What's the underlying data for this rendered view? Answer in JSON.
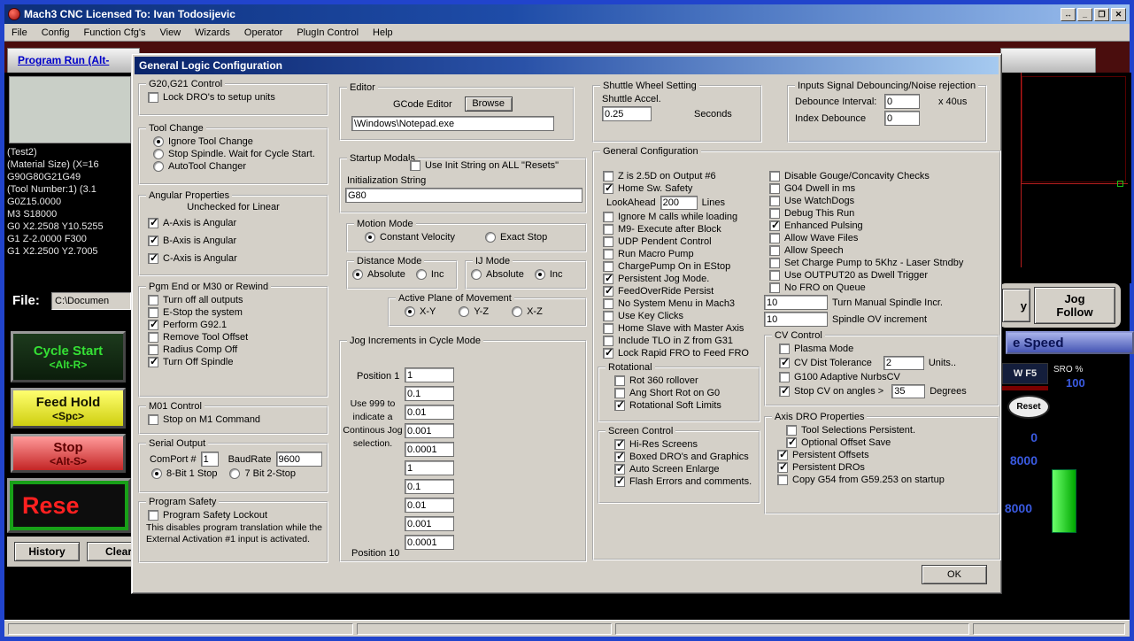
{
  "app": {
    "title": "Mach3 CNC  Licensed To: Ivan Todosijevic",
    "menus": [
      "File",
      "Config",
      "Function Cfg's",
      "View",
      "Wizards",
      "Operator",
      "PlugIn Control",
      "Help"
    ],
    "tab": "Program Run (Alt-",
    "icons": {
      "resize": "↔",
      "minimize": "_",
      "maximize": "❐",
      "close": "✕"
    }
  },
  "left": {
    "gcode": [
      "(Test2)",
      "(Material Size) (X=16",
      "G90G80G21G49",
      "(Tool Number:1) (3.1",
      "G0Z15.0000",
      "M3 S18000",
      "G0 X2.2508 Y10.5255",
      "G1  Z-2.0000 F300",
      "G1 X2.2500 Y2.7005"
    ],
    "file_label": "File:",
    "file_value": "C:\\Documen",
    "cycle_start": "Cycle Start",
    "cycle_start_key": "<Alt-R>",
    "feed_hold": "Feed Hold",
    "feed_hold_key": "<Spc>",
    "stop": "Stop",
    "stop_key": "<Alt-S>",
    "reset": "Rese",
    "history": "History",
    "clear": "Clear"
  },
  "right": {
    "partial_btn": "y",
    "jog1": "Jog",
    "jog2": "Follow",
    "speed_header": "e Speed",
    "fkey": "W F5",
    "sro_label": "SRO %",
    "sro_value": "100",
    "reset_btn": "Reset",
    "v0": "0",
    "v1": "8000",
    "v2": "8000"
  },
  "dialog": {
    "title": "General Logic Configuration",
    "ok": "OK",
    "g20": {
      "title": "G20,G21 Control",
      "lock_dros": {
        "label": "Lock DRO's to setup units",
        "checked": false
      }
    },
    "tool_change": {
      "title": "Tool Change",
      "items": [
        {
          "label": "Ignore Tool Change",
          "checked": true
        },
        {
          "label": "Stop Spindle. Wait for Cycle Start.",
          "checked": false
        },
        {
          "label": "AutoTool Changer",
          "checked": false
        }
      ]
    },
    "angular": {
      "title": "Angular Properties",
      "note": "Unchecked for Linear",
      "items": [
        {
          "label": "A-Axis is Angular",
          "checked": true
        },
        {
          "label": "B-Axis is Angular",
          "checked": true
        },
        {
          "label": "C-Axis is Angular",
          "checked": true
        }
      ]
    },
    "pgm_end": {
      "title": "Pgm End or M30 or Rewind",
      "items": [
        {
          "label": "Turn off all outputs",
          "checked": false
        },
        {
          "label": "E-Stop the system",
          "checked": false
        },
        {
          "label": "Perform G92.1",
          "checked": true
        },
        {
          "label": "Remove Tool Offset",
          "checked": false
        },
        {
          "label": "Radius Comp Off",
          "checked": false
        },
        {
          "label": "Turn Off Spindle",
          "checked": true
        }
      ]
    },
    "m01": {
      "title": "M01 Control",
      "stop_m1": {
        "label": "Stop on M1 Command",
        "checked": false
      }
    },
    "serial": {
      "title": "Serial Output",
      "comport_label": "ComPort #",
      "comport_value": "1",
      "baud_label": "BaudRate",
      "baud_value": "9600",
      "bits": [
        {
          "label": "8-Bit 1 Stop",
          "checked": true
        },
        {
          "label": "7 Bit 2-Stop",
          "checked": false
        }
      ]
    },
    "safety": {
      "title": "Program Safety",
      "lockout": {
        "label": "Program Safety Lockout",
        "checked": false
      },
      "note": "This disables program translation while the\nExternal Activation #1 input is activated."
    },
    "editor": {
      "title": "Editor",
      "label": "GCode Editor",
      "browse": "Browse",
      "path": "\\Windows\\Notepad.exe"
    },
    "startup": {
      "title": "Startup Modals",
      "use_init": {
        "label": "Use Init String on ALL  \"Resets\"",
        "checked": false
      },
      "init_label": "Initialization String",
      "init_value": "G80"
    },
    "motion": {
      "title": "Motion Mode",
      "items": [
        {
          "label": "Constant Velocity",
          "checked": true
        },
        {
          "label": "Exact Stop",
          "checked": false
        }
      ]
    },
    "distance": {
      "title": "Distance Mode",
      "items": [
        {
          "label": "Absolute",
          "checked": true
        },
        {
          "label": "Inc",
          "checked": false
        }
      ]
    },
    "ij": {
      "title": "IJ Mode",
      "items": [
        {
          "label": "Absolute",
          "checked": false
        },
        {
          "label": "Inc",
          "checked": true
        }
      ]
    },
    "plane": {
      "title": "Active Plane of Movement",
      "items": [
        {
          "label": "X-Y",
          "checked": true
        },
        {
          "label": "Y-Z",
          "checked": false
        },
        {
          "label": "X-Z",
          "checked": false
        }
      ]
    },
    "jog": {
      "title": "Jog Increments in Cycle Mode",
      "pos1_label": "Position 1",
      "pos10_label": "Position 10",
      "note": "Use 999 to\nindicate a\nContinous Jog\nselection.",
      "values": [
        "1",
        "0.1",
        "0.01",
        "0.001",
        "0.0001",
        "1",
        "0.1",
        "0.01",
        "0.001",
        "0.0001"
      ]
    },
    "shuttle": {
      "title": "Shuttle Wheel Setting",
      "accel_label": "Shuttle Accel.",
      "accel_value": "0.25",
      "unit": "Seconds"
    },
    "debounce": {
      "title": "Inputs Signal Debouncing/Noise rejection",
      "interval_label": "Debounce Interval:",
      "interval_value": "0",
      "unit": "x 40us",
      "index_label": "Index Debounce",
      "index_value": "0"
    },
    "general": {
      "title": "General Configuration",
      "left": [
        {
          "label": "Z is 2.5D on Output #6",
          "checked": false
        },
        {
          "label": "Home Sw. Safety",
          "checked": true
        }
      ],
      "lookahead_label": "LookAhead",
      "lookahead_value": "200",
      "lookahead_unit": "Lines",
      "left2": [
        {
          "label": "Ignore M calls while loading",
          "checked": false
        },
        {
          "label": "M9- Execute after Block",
          "checked": false
        },
        {
          "label": "UDP Pendent Control",
          "checked": false
        },
        {
          "label": "Run Macro Pump",
          "checked": false
        },
        {
          "label": "ChargePump On in EStop",
          "checked": false
        },
        {
          "label": "Persistent Jog Mode.",
          "checked": true
        },
        {
          "label": "FeedOverRide Persist",
          "checked": true
        },
        {
          "label": "No System Menu in Mach3",
          "checked": false
        },
        {
          "label": "Use Key Clicks",
          "checked": false
        },
        {
          "label": "Home Slave with Master Axis",
          "checked": false
        },
        {
          "label": "Include TLO in Z from G31",
          "checked": false
        },
        {
          "label": "Lock Rapid FRO to Feed FRO",
          "checked": true
        }
      ],
      "right": [
        {
          "label": "Disable Gouge/Concavity Checks",
          "checked": false
        },
        {
          "label": "G04 Dwell in ms",
          "checked": false
        },
        {
          "label": "Use WatchDogs",
          "checked": false
        },
        {
          "label": "Debug This Run",
          "checked": false
        },
        {
          "label": "Enhanced Pulsing",
          "checked": true
        },
        {
          "label": "Allow Wave Files",
          "checked": false
        },
        {
          "label": "Allow Speech",
          "checked": false
        },
        {
          "label": "Set Charge Pump to 5Khz - Laser Stndby",
          "checked": false
        },
        {
          "label": "Use OUTPUT20 as Dwell Trigger",
          "checked": false
        },
        {
          "label": "No FRO on Queue",
          "checked": false
        }
      ],
      "spindle_incr_value": "10",
      "spindle_incr_label": "Turn Manual Spindle Incr.",
      "spindle_ov_value": "10",
      "spindle_ov_label": "Spindle OV increment"
    },
    "rotational": {
      "title": "Rotational",
      "items": [
        {
          "label": "Rot 360 rollover",
          "checked": false
        },
        {
          "label": "Ang Short Rot on G0",
          "checked": false
        },
        {
          "label": "Rotational Soft Limits",
          "checked": true
        }
      ]
    },
    "screen": {
      "title": "Screen Control",
      "items": [
        {
          "label": "Hi-Res Screens",
          "checked": true
        },
        {
          "label": "Boxed DRO's and Graphics",
          "checked": true
        },
        {
          "label": "Auto Screen Enlarge",
          "checked": true
        },
        {
          "label": "Flash Errors and comments.",
          "checked": true
        }
      ]
    },
    "cv": {
      "title": "CV Control",
      "plasma": {
        "label": "Plasma Mode",
        "checked": false
      },
      "dist": {
        "label": "CV Dist Tolerance",
        "checked": true
      },
      "dist_value": "2",
      "dist_unit": "Units..",
      "nurbs": {
        "label": "G100 Adaptive NurbsCV",
        "checked": false
      },
      "angles": {
        "label": "Stop CV on angles >",
        "checked": true
      },
      "angles_value": "35",
      "angles_unit": "Degrees"
    },
    "axis_dro": {
      "title": "Axis DRO Properties",
      "items": [
        {
          "label": "Tool Selections Persistent.",
          "checked": false
        },
        {
          "label": "Optional Offset Save",
          "checked": true
        },
        {
          "label": "Persistent Offsets",
          "checked": true
        },
        {
          "label": "Persistent DROs",
          "checked": true
        },
        {
          "label": "Copy G54 from G59.253 on startup",
          "checked": false
        }
      ]
    }
  }
}
